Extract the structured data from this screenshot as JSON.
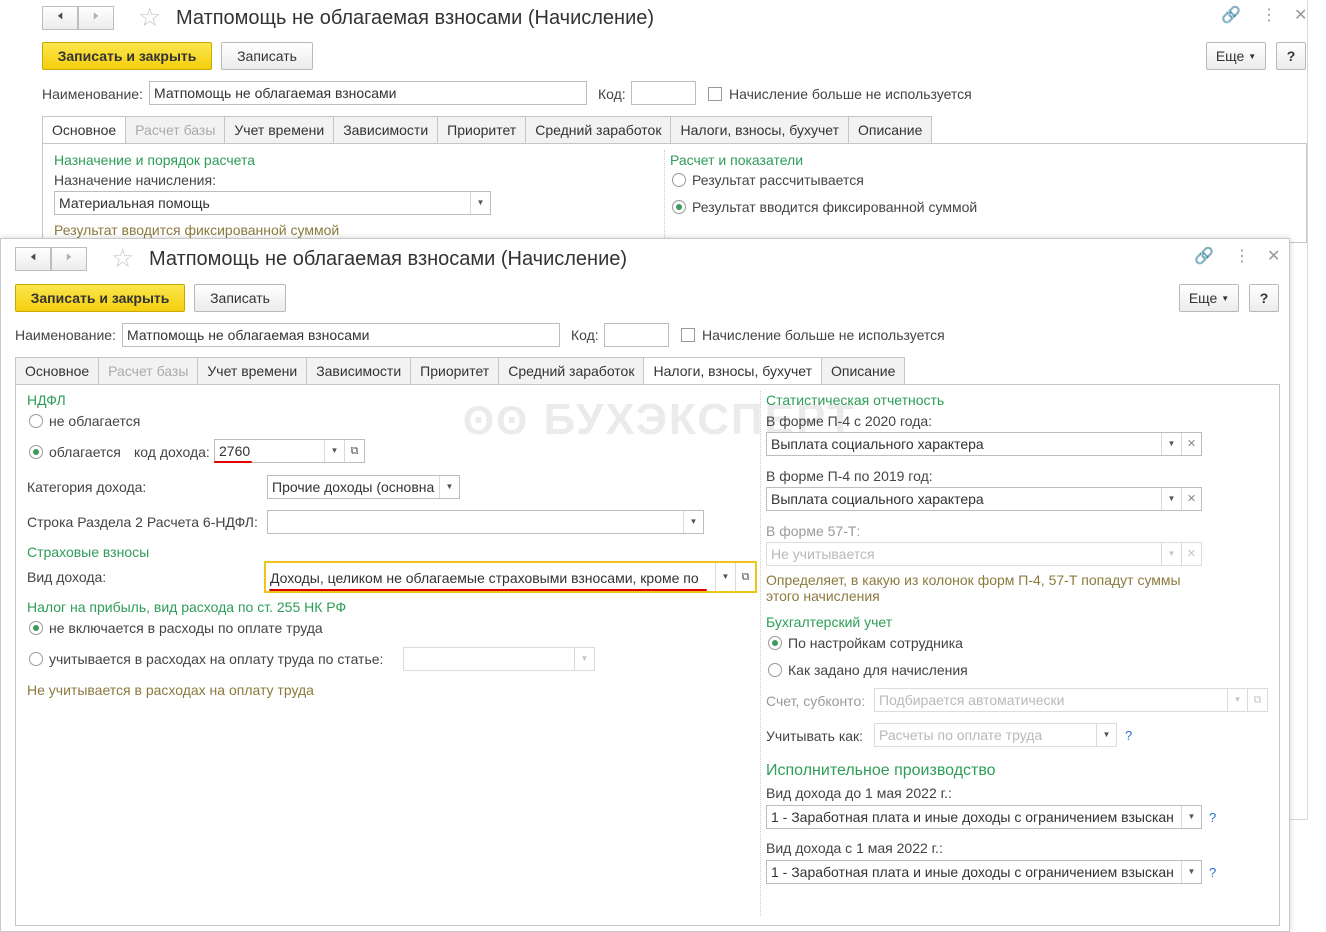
{
  "back": {
    "title": "Матпомощь не облагаемая взносами (Начисление)",
    "save_close": "Записать и закрыть",
    "save": "Записать",
    "more": "Еще",
    "help": "?",
    "name_label": "Наименование:",
    "name_value": "Матпомощь не облагаемая взносами",
    "code_label": "Код:",
    "code_value": "",
    "not_used_label": "Начисление больше не используется",
    "tabs": [
      "Основное",
      "Расчет базы",
      "Учет времени",
      "Зависимости",
      "Приоритет",
      "Средний заработок",
      "Налоги, взносы, бухучет",
      "Описание"
    ],
    "section_purpose": "Назначение и порядок расчета",
    "purpose_label": "Назначение начисления:",
    "purpose_value": "Материальная помощь",
    "fixed_note": "Результат вводится фиксированной суммой",
    "section_calc": "Расчет и показатели",
    "radio_calc": "Результат рассчитывается",
    "radio_fixed": "Результат вводится фиксированной суммой"
  },
  "front": {
    "title": "Матпомощь не облагаемая взносами (Начисление)",
    "save_close": "Записать и закрыть",
    "save": "Записать",
    "more": "Еще",
    "help": "?",
    "name_label": "Наименование:",
    "name_value": "Матпомощь не облагаемая взносами",
    "code_label": "Код:",
    "code_value": "",
    "not_used_label": "Начисление больше не используется",
    "tabs": [
      "Основное",
      "Расчет базы",
      "Учет времени",
      "Зависимости",
      "Приоритет",
      "Средний заработок",
      "Налоги, взносы, бухучет",
      "Описание"
    ],
    "watermark": "БУХЭКСПЕРТ",
    "ndfl": {
      "header": "НДФЛ",
      "not_taxed": "не облагается",
      "taxed": "облагается",
      "income_code_label": "код дохода:",
      "income_code_value": "2760",
      "income_category_label": "Категория дохода:",
      "income_category_value": "Прочие доходы (основна",
      "line_6ndfl_label": "Строка Раздела 2 Расчета 6-НДФЛ:",
      "line_6ndfl_value": ""
    },
    "insurance": {
      "header": "Страховые взносы",
      "income_type_label": "Вид дохода:",
      "income_type_value": "Доходы, целиком не облагаемые страховыми взносами, кроме по"
    },
    "profit_tax": {
      "header": "Налог на прибыль, вид расхода по ст. 255 НК РФ",
      "not_included": "не включается в расходы по оплате труда",
      "included_by_article": "учитывается в расходах на оплату труда по статье:",
      "article_value": "",
      "note": "Не учитывается в расходах на оплату труда"
    },
    "stats": {
      "header": "Статистическая отчетность",
      "p4_2020_label": "В форме П-4 с 2020 года:",
      "p4_2020_value": "Выплата социального характера",
      "p4_2019_label": "В форме П-4 по 2019 год:",
      "p4_2019_value": "Выплата социального характера",
      "f57t_label": "В форме 57-Т:",
      "f57t_value": "Не учитывается",
      "note_line1": "Определяет, в какую из колонок форм П-4, 57-Т попадут суммы",
      "note_line2": "этого начисления"
    },
    "accounting": {
      "header": "Бухгалтерский учет",
      "by_employee": "По настройкам сотрудника",
      "as_set": "Как задано для начисления",
      "account_label": "Счет, субконто:",
      "account_value": "Подбирается автоматически",
      "treat_as_label": "Учитывать как:",
      "treat_as_value": "Расчеты по оплате труда"
    },
    "enforcement": {
      "header": "Исполнительное производство",
      "before_label": "Вид дохода до 1 мая 2022 г.:",
      "before_value": "1 - Заработная плата и иные доходы с ограничением взыскан",
      "after_label": "Вид дохода с 1 мая 2022 г.:",
      "after_value": "1 - Заработная плата и иные доходы с ограничением взыскан"
    }
  }
}
